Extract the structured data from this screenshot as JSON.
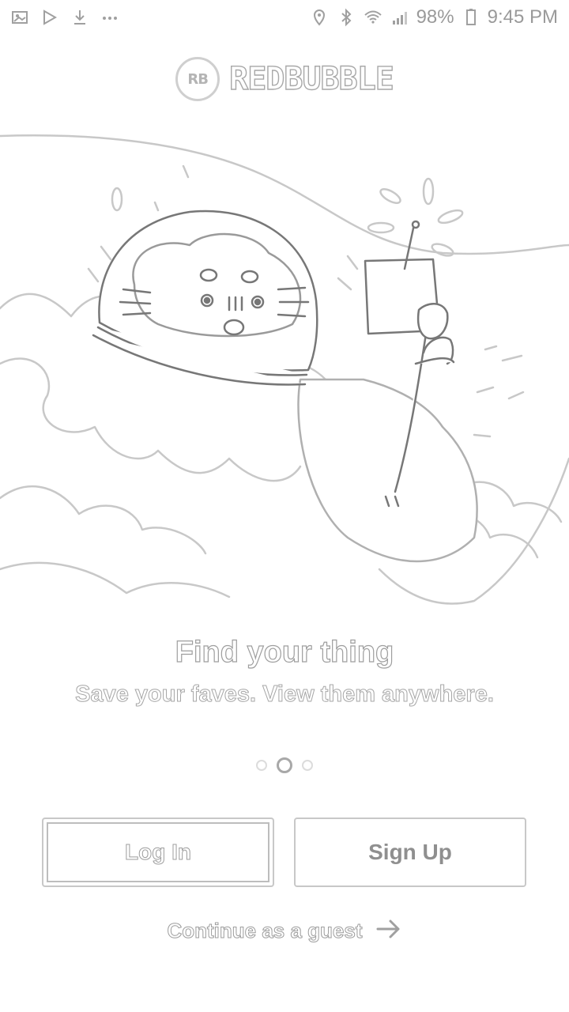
{
  "status_bar": {
    "left_icons": [
      "image-icon",
      "play-store-icon",
      "download-icon",
      "more-dots-icon"
    ],
    "battery": "98%",
    "time": "9:45 PM"
  },
  "header": {
    "logo_mark": "RB",
    "logo_text": "REDBUBBLE"
  },
  "onboarding": {
    "title": "Find your thing",
    "subtitle": "Save your faves. View them anywhere.",
    "page_count": 3,
    "active_page": 2
  },
  "actions": {
    "login_label": "Log In",
    "signup_label": "Sign Up",
    "guest_label": "Continue as a guest"
  },
  "colors": {
    "background": "#ffffff",
    "outline": "#a8a8a8"
  }
}
